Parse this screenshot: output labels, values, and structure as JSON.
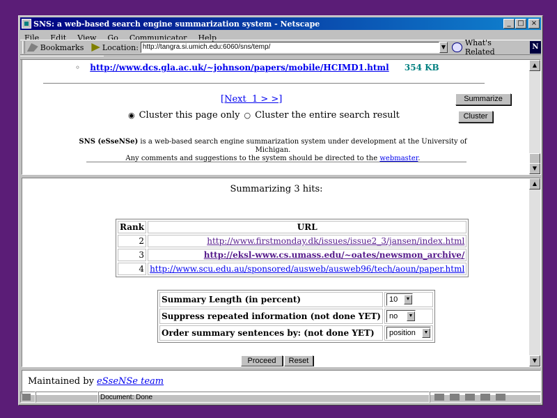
{
  "window": {
    "title": "SNS: a web-based search engine summarization system - Netscape"
  },
  "menu": [
    "File",
    "Edit",
    "View",
    "Go",
    "Communicator",
    "Help"
  ],
  "toolbar": {
    "bookmarks_label": "Bookmarks",
    "location_label": "Location:",
    "location_value": "http://tangra.si.umich.edu:6060/sns/temp/",
    "whats_related": "What's Related"
  },
  "frame1": {
    "prev_link": "http://www.dcs.gla.ac.uk/~johnson/papers/mobile/HCIMD1.html",
    "prev_size": "354 KB",
    "next_link": "[Next  1 > >]",
    "summarize_button": "Summarize",
    "cluster_option_page": "Cluster this page only",
    "cluster_option_all": "Cluster the entire search result",
    "cluster_button": "Cluster",
    "footer_bold": "SNS (eSseNSe)",
    "footer_text1": " is a web-based search engine summarization system under development at the University of Michigan.",
    "footer_text2": "Any comments and suggestions to the system should be directed to the ",
    "footer_link": "webmaster",
    "footer_end": "."
  },
  "frame2": {
    "heading": "Summarizing 3 hits:",
    "table_headers": [
      "Rank",
      "URL"
    ],
    "rows": [
      {
        "rank": "2",
        "url": "http://www.firstmonday.dk/issues/issue2_3/jansen/index.html"
      },
      {
        "rank": "3",
        "url": "http://eksl-www.cs.umass.edu/~oates/newsmon_archive/"
      },
      {
        "rank": "4",
        "url": "http://www.scu.edu.au/sponsored/ausweb/ausweb96/tech/aoun/paper.html"
      }
    ],
    "options": [
      {
        "label": "Summary Length (in percent)",
        "value": "10"
      },
      {
        "label": "Suppress repeated information (not done YET)",
        "value": "no"
      },
      {
        "label": "Order summary sentences by: (not done YET)",
        "value": "position"
      }
    ],
    "proceed_button": "Proceed",
    "reset_button": "Reset"
  },
  "frame3": {
    "maintained_by": "Maintained by ",
    "team_link": "eSseNSe team"
  },
  "status": {
    "text": "Document: Done"
  }
}
